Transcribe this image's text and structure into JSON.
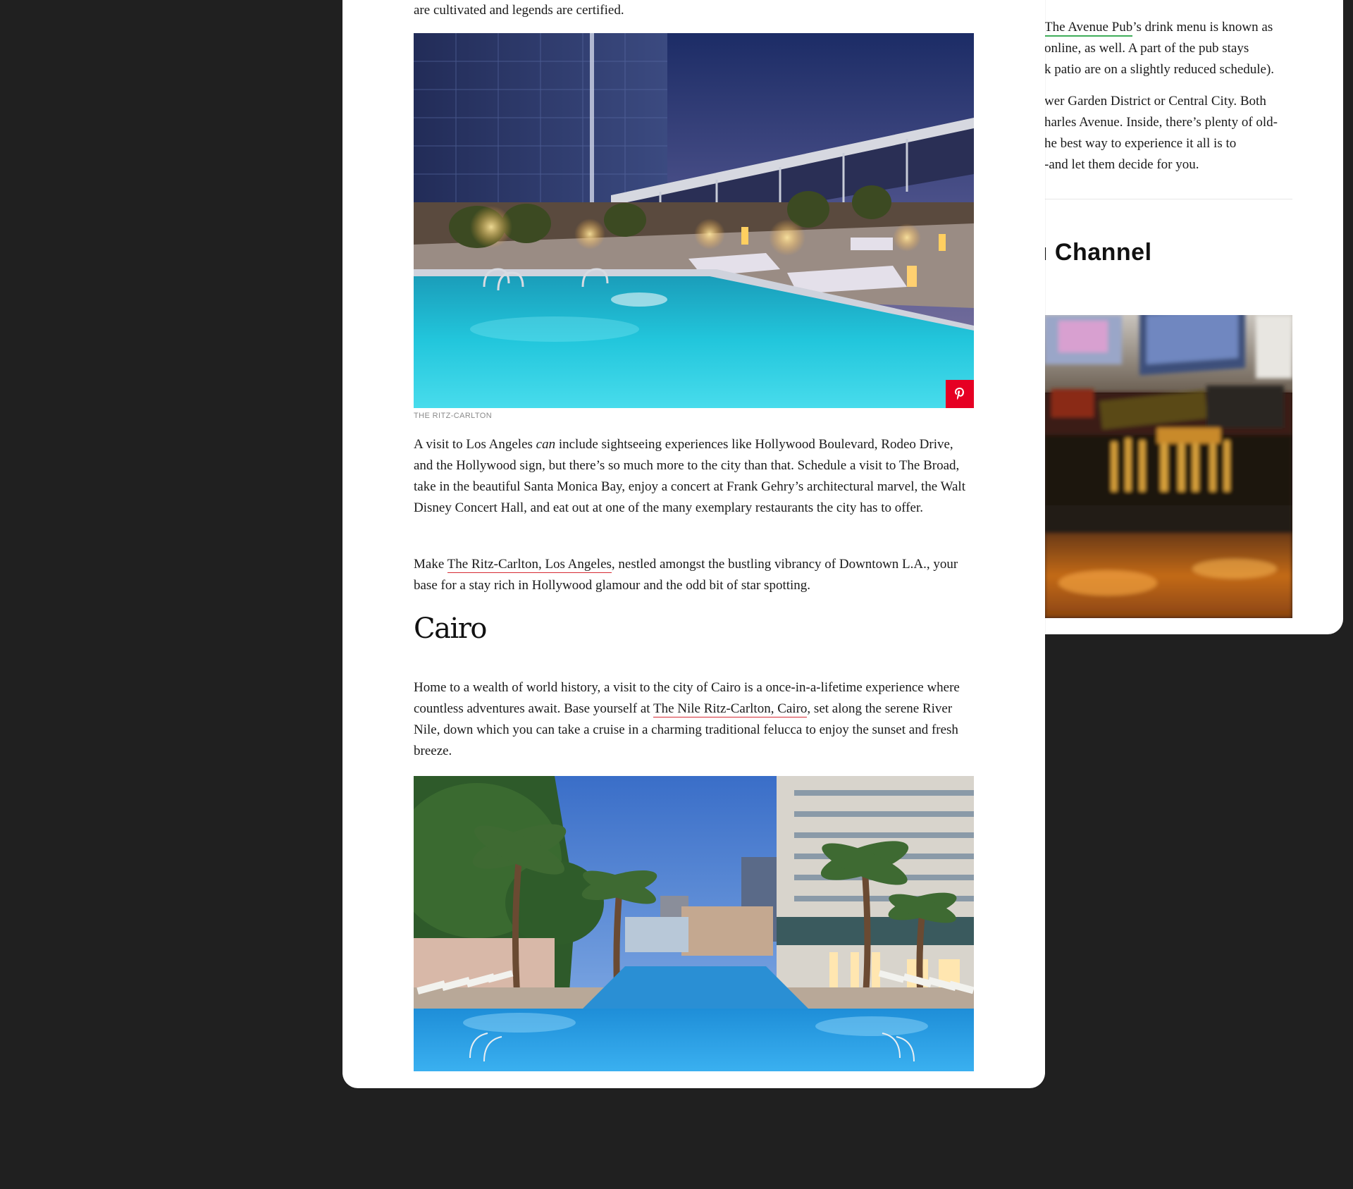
{
  "right_card": {
    "para1": {
      "link": "The Avenue Pub",
      "after_link": "’s drink menu is known as",
      "line2": "online, as well. A part of the pub stays",
      "line3": "k patio are on a slightly reduced schedule)."
    },
    "para2": {
      "line1": "wer Garden District or Central City. Both",
      "line2": "harles Avenue. Inside, there’s plenty of old-",
      "line3": "he best way to experience it all is to",
      "line4": "-and let them decide for you."
    },
    "heading": "ı Channel",
    "image_name": "bar-taps-photo"
  },
  "article": {
    "top_line": "are cultivated and legends are certified.",
    "la_image": {
      "name": "ritz-carlton-los-angeles-rooftop-pool",
      "credit": "THE RITZ-CARLTON",
      "pin_icon": "pinterest-icon",
      "pin_color": "#e60023"
    },
    "la_para1": {
      "before_em": "A visit to Los Angeles ",
      "em": "can",
      "after_em": " include sightseeing experiences like Hollywood Boulevard, Rodeo Drive, and the Hollywood sign, but there’s so much more to the city than that. Schedule a visit to The Broad, take in the beautiful Santa Monica Bay, enjoy a concert at Frank Gehry’s architectural marvel, the Walt Disney Concert Hall, and eat out at one of the many exemplary restaurants the city has to offer."
    },
    "la_para2": {
      "before_link": "Make ",
      "link": "The Ritz-Carlton, Los Angeles",
      "after_link": ", nestled amongst the bustling vibrancy of Downtown L.A., your base for a stay rich in Hollywood glamour and the odd bit of star spotting."
    },
    "cairo_heading": "Cairo",
    "cairo_para": {
      "before_link": "Home to a wealth of world history, a visit to the city of Cairo is a once-in-a-lifetime experience where countless adventures await. Base yourself at ",
      "link": "The Nile Ritz-Carlton, Cairo",
      "after_link": ", set along the serene River Nile, down which you can take a cruise in a charming traditional felucca to enjoy the sunset and fresh breeze."
    },
    "cairo_image": {
      "name": "nile-ritz-carlton-cairo-pool"
    },
    "link_underline_color": "#d62b34"
  },
  "colors": {
    "page_background": "#202020",
    "card_background": "#ffffff",
    "green_link_underline": "#3fae5a"
  }
}
